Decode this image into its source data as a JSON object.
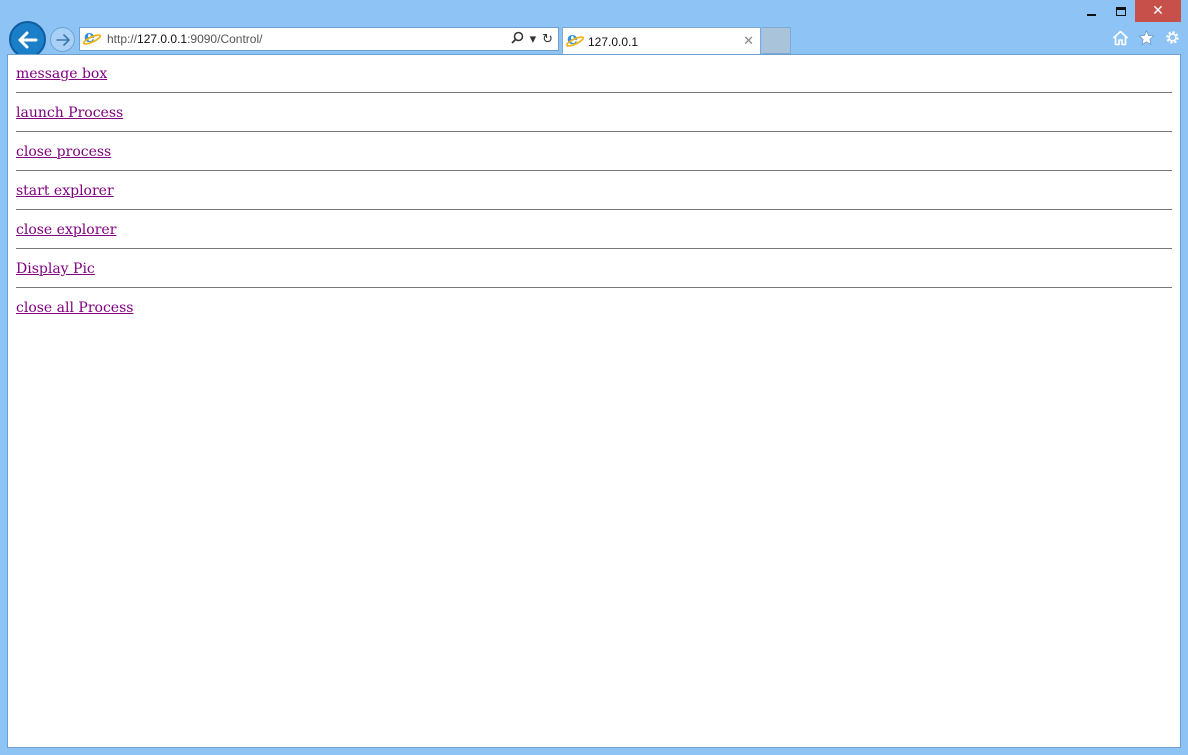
{
  "browser": {
    "address": {
      "scheme": "http://",
      "host": "127.0.0.1",
      "path": ":9090/Control/"
    },
    "tab": {
      "title": "127.0.0.1",
      "close_glyph": "✕"
    },
    "search_glyph": "⚲",
    "dropdown_glyph": "▾",
    "refresh_glyph": "↻"
  },
  "page": {
    "links": [
      {
        "label": "message box"
      },
      {
        "label": "launch Process"
      },
      {
        "label": "close process"
      },
      {
        "label": "start explorer"
      },
      {
        "label": "close explorer"
      },
      {
        "label": "Display Pic"
      },
      {
        "label": "close all Process"
      }
    ]
  },
  "colors": {
    "frame": "#8ec4f5",
    "visited_link": "#800080",
    "close_button": "#c7504b",
    "back_button": "#1a7ec8"
  },
  "icons": {
    "back": "arrow-left-icon",
    "forward": "arrow-right-icon",
    "site": "ie-logo-icon",
    "home": "home-icon",
    "favorites": "star-icon",
    "tools": "gear-icon"
  }
}
